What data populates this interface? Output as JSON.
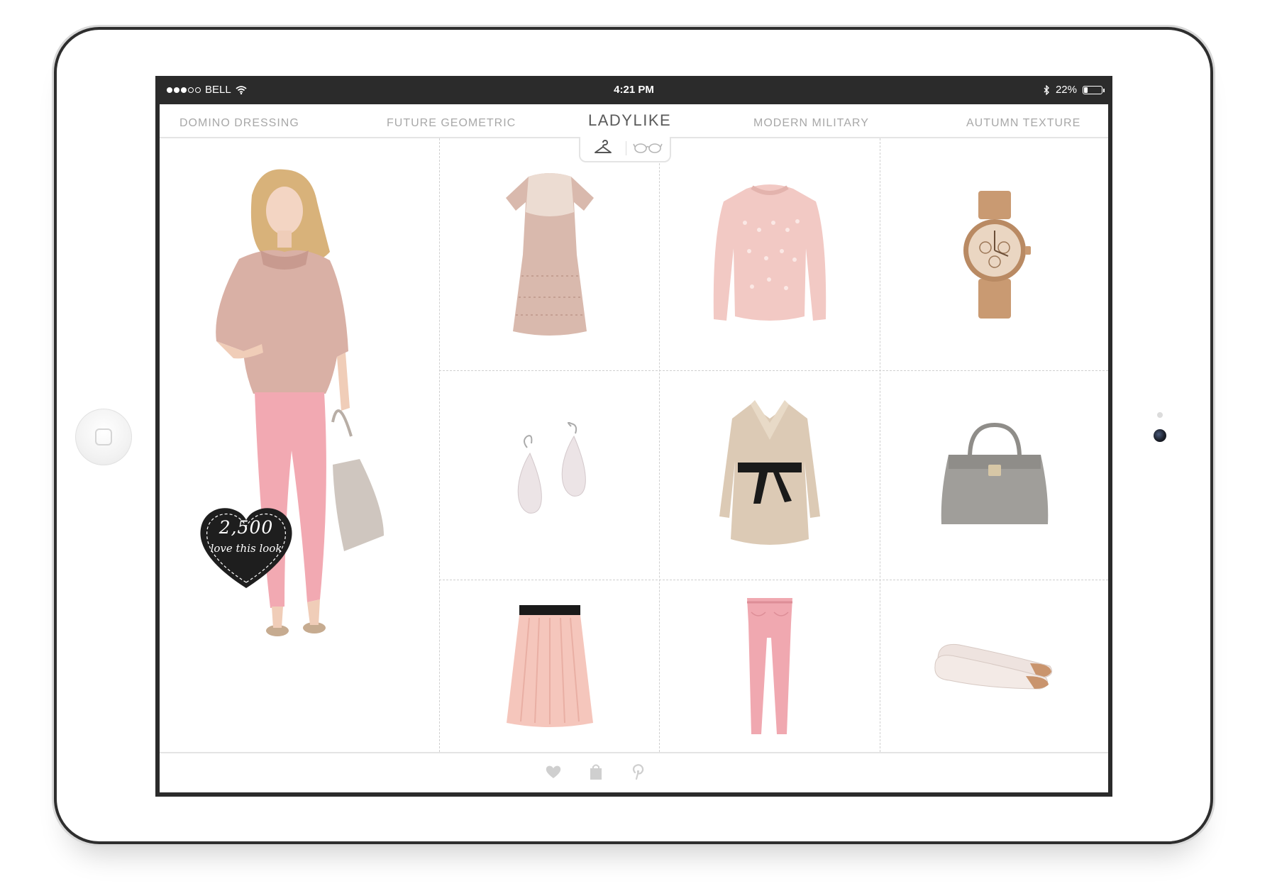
{
  "status_bar": {
    "carrier": "BELL",
    "time": "4:21 PM",
    "battery": "22%",
    "battery_level": 0.22,
    "signal_bars_filled": 3,
    "signal_bars_total": 5
  },
  "tabs": [
    {
      "label": "DOMINO DRESSING",
      "active": false
    },
    {
      "label": "FUTURE GEOMETRIC",
      "active": false
    },
    {
      "label": "LADYLIKE",
      "active": true
    },
    {
      "label": "MODERN MILITARY",
      "active": false
    },
    {
      "label": "AUTUMN TEXTURE",
      "active": false
    }
  ],
  "view_toggle": {
    "icons": [
      "hanger-icon",
      "glasses-icon"
    ]
  },
  "look": {
    "love_count": "2,500",
    "love_text": "love this look"
  },
  "products": [
    {
      "name": "lace-dress",
      "color": "#d9b9ad"
    },
    {
      "name": "knit-sweater",
      "color": "#f2c9c4"
    },
    {
      "name": "rose-gold-watch",
      "color": "#c99a72"
    },
    {
      "name": "teardrop-earrings",
      "color": "#ece4e6"
    },
    {
      "name": "belted-trench-coat",
      "color": "#dccab5"
    },
    {
      "name": "grey-handbag",
      "color": "#a09e9a"
    },
    {
      "name": "pleated-skirt",
      "color": "#f5c6bc"
    },
    {
      "name": "pink-jeans",
      "color": "#f0a8b0"
    },
    {
      "name": "cap-toe-flats",
      "color": "#eee3df"
    }
  ],
  "bottom_bar": {
    "icons": [
      "heart-icon",
      "shopping-bag-icon",
      "pinterest-icon"
    ]
  },
  "colors": {
    "screen_bezel": "#2b2b2b",
    "tab_active": "#5a5a5a",
    "tab_inactive": "#a8a8a8",
    "heart_badge": "#1e1e1e"
  }
}
